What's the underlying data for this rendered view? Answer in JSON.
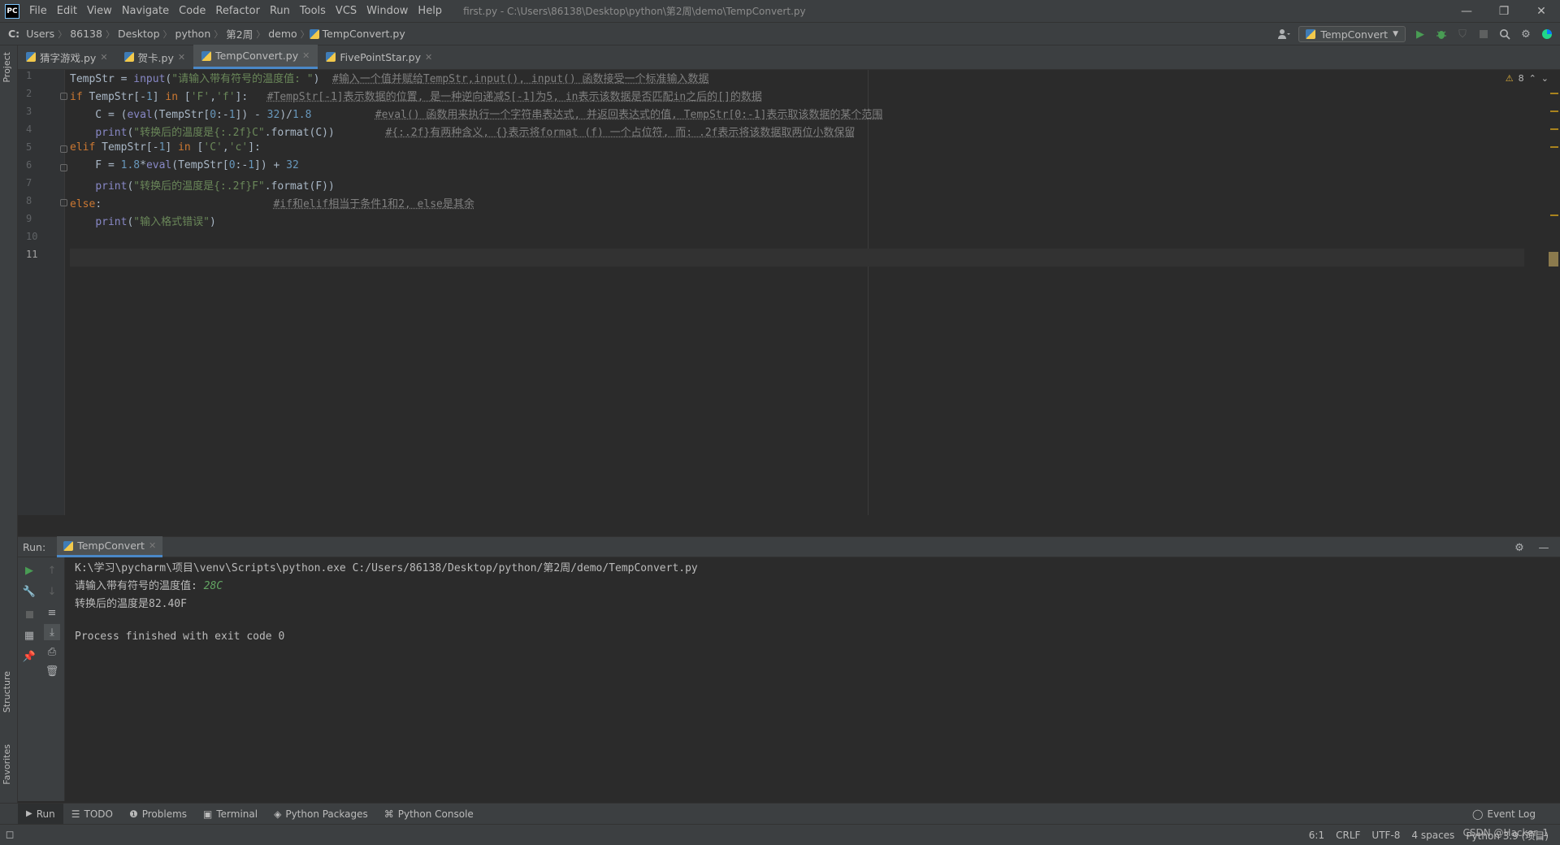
{
  "titlebar": {
    "logo": "PC",
    "menu": [
      "File",
      "Edit",
      "View",
      "Navigate",
      "Code",
      "Refactor",
      "Run",
      "Tools",
      "VCS",
      "Window",
      "Help"
    ],
    "window_title": "first.py - C:\\Users\\86138\\Desktop\\python\\第2周\\demo\\TempConvert.py",
    "controls": [
      "—",
      "❐",
      "✕"
    ]
  },
  "navbar": {
    "drive": "C:",
    "crumbs": [
      "Users",
      "86138",
      "Desktop",
      "python",
      "第2周",
      "demo",
      "TempConvert.py"
    ],
    "run_config": "TempConvert"
  },
  "left_strip": {
    "project": "Project",
    "structure": "Structure",
    "favorites": "Favorites"
  },
  "tabs": [
    {
      "label": "猜字游戏.py",
      "active": false
    },
    {
      "label": "贺卡.py",
      "active": false
    },
    {
      "label": "TempConvert.py",
      "active": true
    },
    {
      "label": "FivePointStar.py",
      "active": false
    }
  ],
  "editor": {
    "line_numbers": [
      "1",
      "2",
      "3",
      "4",
      "5",
      "6",
      "7",
      "8",
      "9",
      "10",
      "11"
    ],
    "current_line": 11,
    "warning_count": "8",
    "code": [
      [
        {
          "t": "TempStr = "
        },
        {
          "t": "input",
          "c": "bi"
        },
        {
          "t": "("
        },
        {
          "t": "\"请输入带有符号的温度值: \"",
          "c": "str"
        },
        {
          "t": ")  "
        },
        {
          "t": "#输入一个值并赋给TempStr,input(), input() 函数接受一个标准输入数据",
          "c": "cm"
        }
      ],
      [
        {
          "t": "if",
          "c": "kw"
        },
        {
          "t": " TempStr[-"
        },
        {
          "t": "1",
          "c": "num"
        },
        {
          "t": "] "
        },
        {
          "t": "in",
          "c": "kw"
        },
        {
          "t": " ["
        },
        {
          "t": "'F'",
          "c": "str"
        },
        {
          "t": ","
        },
        {
          "t": "'f'",
          "c": "str"
        },
        {
          "t": "]:   "
        },
        {
          "t": "#TempStr[-1]表示数据的位置, 是一种逆向递减S[-1]为5, in表示该数据是否匹配in之后的[]的数据",
          "c": "cm"
        }
      ],
      [
        {
          "t": "    C = ("
        },
        {
          "t": "eval",
          "c": "bi"
        },
        {
          "t": "(TempStr["
        },
        {
          "t": "0",
          "c": "num"
        },
        {
          "t": ":-"
        },
        {
          "t": "1",
          "c": "num"
        },
        {
          "t": "]) - "
        },
        {
          "t": "32",
          "c": "num"
        },
        {
          "t": ")/"
        },
        {
          "t": "1.8",
          "c": "num"
        },
        {
          "t": "          "
        },
        {
          "t": "#eval() 函数用来执行一个字符串表达式, 并返回表达式的值, TempStr[0:-1]表示取该数据的某个范围",
          "c": "cm"
        }
      ],
      [
        {
          "t": "    "
        },
        {
          "t": "print",
          "c": "bi"
        },
        {
          "t": "("
        },
        {
          "t": "\"转换后的温度是{:.2f}C\"",
          "c": "str"
        },
        {
          "t": ".format(C))        "
        },
        {
          "t": "#{:.2f}有两种含义, {}表示将format (f) 一个占位符, 而: .2f表示将该数据取两位小数保留",
          "c": "cm"
        }
      ],
      [
        {
          "t": "elif",
          "c": "kw"
        },
        {
          "t": " TempStr[-"
        },
        {
          "t": "1",
          "c": "num"
        },
        {
          "t": "] "
        },
        {
          "t": "in",
          "c": "kw"
        },
        {
          "t": " ["
        },
        {
          "t": "'C'",
          "c": "str"
        },
        {
          "t": ","
        },
        {
          "t": "'c'",
          "c": "str"
        },
        {
          "t": "]:"
        }
      ],
      [
        {
          "t": "    F = "
        },
        {
          "t": "1.8",
          "c": "num"
        },
        {
          "t": "*"
        },
        {
          "t": "eval",
          "c": "bi"
        },
        {
          "t": "(TempStr["
        },
        {
          "t": "0",
          "c": "num"
        },
        {
          "t": ":-"
        },
        {
          "t": "1",
          "c": "num"
        },
        {
          "t": "]) + "
        },
        {
          "t": "32",
          "c": "num"
        }
      ],
      [
        {
          "t": "    "
        },
        {
          "t": "print",
          "c": "bi"
        },
        {
          "t": "("
        },
        {
          "t": "\"转换后的温度是{:.2f}F\"",
          "c": "str"
        },
        {
          "t": ".format(F))"
        }
      ],
      [
        {
          "t": "else",
          "c": "kw"
        },
        {
          "t": ":                           "
        },
        {
          "t": "#if和elif相当于条件1和2, else是其余",
          "c": "cm"
        }
      ],
      [
        {
          "t": "    "
        },
        {
          "t": "print",
          "c": "bi"
        },
        {
          "t": "("
        },
        {
          "t": "\"输入格式错误\"",
          "c": "str"
        },
        {
          "t": ")"
        }
      ],
      [
        {
          "t": ""
        }
      ],
      [
        {
          "t": ""
        }
      ]
    ]
  },
  "run": {
    "label": "Run:",
    "tab": "TempConvert",
    "console": {
      "command": "K:\\学习\\pycharm\\项目\\venv\\Scripts\\python.exe C:/Users/86138/Desktop/python/第2周/demo/TempConvert.py",
      "prompt": "请输入带有符号的温度值: ",
      "user_input": "28C",
      "output": "转换后的温度是82.40F",
      "blank": "",
      "exit": "Process finished with exit code 0"
    }
  },
  "bottom_tools": {
    "items": [
      "Run",
      "TODO",
      "Problems",
      "Terminal",
      "Python Packages",
      "Python Console"
    ],
    "event_log": "Event Log"
  },
  "statusbar": {
    "position": "6:1",
    "line_sep": "CRLF",
    "encoding": "UTF-8",
    "indent": "4 spaces",
    "interpreter": "Python 3.9 (项目)"
  },
  "watermark": "CSDN @Hacker_1"
}
